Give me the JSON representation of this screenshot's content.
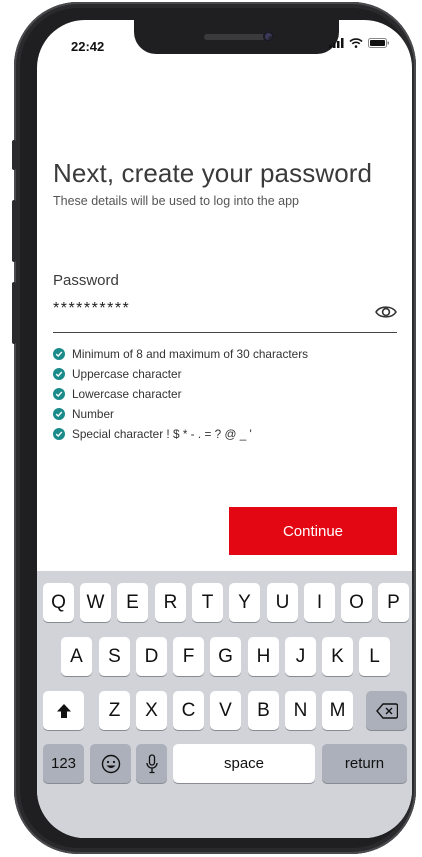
{
  "status_bar": {
    "time": "22:42"
  },
  "header": {
    "title": "Next, create your password",
    "subtitle": "These details will be used to log into the app"
  },
  "password": {
    "label": "Password",
    "value": "**********"
  },
  "requirements": [
    "Minimum of 8 and maximum of 30 characters",
    "Uppercase character",
    "Lowercase character",
    "Number",
    "Special character ! $ * - . = ? @ _ '"
  ],
  "continue_label": "Continue",
  "keyboard": {
    "row1": [
      "Q",
      "W",
      "E",
      "R",
      "T",
      "Y",
      "U",
      "I",
      "O",
      "P"
    ],
    "row2": [
      "A",
      "S",
      "D",
      "F",
      "G",
      "H",
      "J",
      "K",
      "L"
    ],
    "row3": [
      "Z",
      "X",
      "C",
      "V",
      "B",
      "N",
      "M"
    ],
    "numbers_label": "123",
    "space_label": "space",
    "return_label": "return"
  },
  "colors": {
    "accent": "#e30613",
    "check": "#1b8a8a"
  }
}
